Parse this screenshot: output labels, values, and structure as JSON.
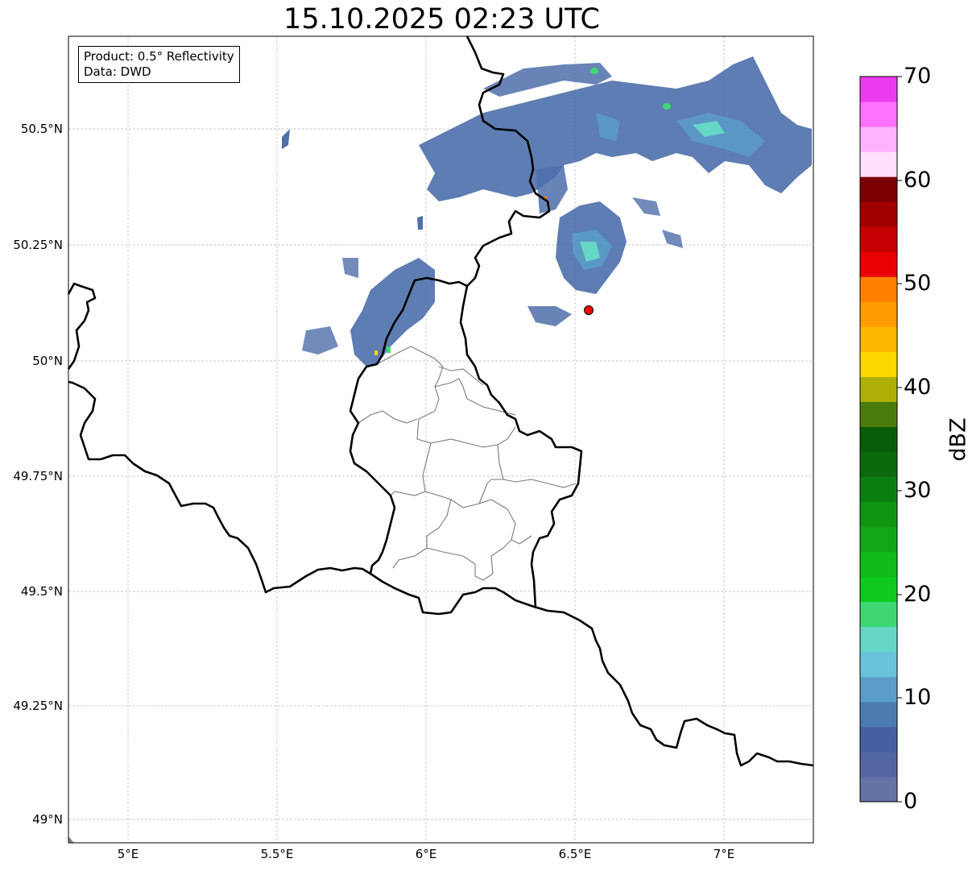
{
  "title": "15.10.2025 02:23 UTC",
  "info": {
    "product": "Product: 0.5° Reflectivity",
    "data": "Data: DWD"
  },
  "axes": {
    "lat_labels": [
      "50.5°N",
      "50.25°N",
      "50°N",
      "49.75°N",
      "49.5°N",
      "49.25°N",
      "49°N"
    ],
    "lon_labels": [
      "5°E",
      "5.5°E",
      "6°E",
      "6.5°E",
      "7°E"
    ]
  },
  "colorbar": {
    "label": "dBZ",
    "ticks": [
      "70",
      "60",
      "50",
      "40",
      "30",
      "20",
      "10",
      "0"
    ],
    "colors": [
      "#6373a6",
      "#5366a1",
      "#4460a3",
      "#4b7aae",
      "#5a9ec8",
      "#68c3dd",
      "#66d7c7",
      "#3fd774",
      "#10c91d",
      "#12ba1a",
      "#10a615",
      "#0e9512",
      "#0b7e10",
      "#0a6a0c",
      "#085c09",
      "#4a7b0c",
      "#adb007",
      "#ffd800",
      "#ffb800",
      "#ff9c00",
      "#ff7f00",
      "#e80000",
      "#c40000",
      "#a10000",
      "#7c0000",
      "#ffe0ff",
      "#ffb3ff",
      "#ff72ff",
      "#ec3bee"
    ]
  },
  "radar_site": {
    "name": "radar-site-marker",
    "color": "#ff0000"
  }
}
